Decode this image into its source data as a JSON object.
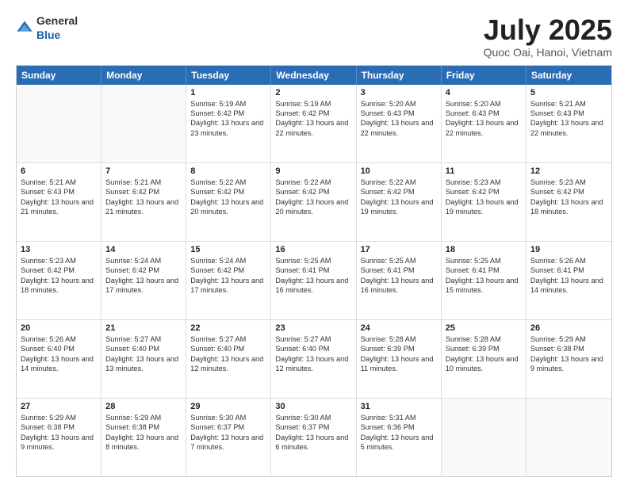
{
  "header": {
    "logo_general": "General",
    "logo_blue": "Blue",
    "month_title": "July 2025",
    "subtitle": "Quoc Oai, Hanoi, Vietnam"
  },
  "calendar": {
    "days_of_week": [
      "Sunday",
      "Monday",
      "Tuesday",
      "Wednesday",
      "Thursday",
      "Friday",
      "Saturday"
    ],
    "rows": [
      [
        {
          "day": "",
          "sunrise": "",
          "sunset": "",
          "daylight": ""
        },
        {
          "day": "",
          "sunrise": "",
          "sunset": "",
          "daylight": ""
        },
        {
          "day": "1",
          "sunrise": "Sunrise: 5:19 AM",
          "sunset": "Sunset: 6:42 PM",
          "daylight": "Daylight: 13 hours and 23 minutes."
        },
        {
          "day": "2",
          "sunrise": "Sunrise: 5:19 AM",
          "sunset": "Sunset: 6:42 PM",
          "daylight": "Daylight: 13 hours and 22 minutes."
        },
        {
          "day": "3",
          "sunrise": "Sunrise: 5:20 AM",
          "sunset": "Sunset: 6:43 PM",
          "daylight": "Daylight: 13 hours and 22 minutes."
        },
        {
          "day": "4",
          "sunrise": "Sunrise: 5:20 AM",
          "sunset": "Sunset: 6:43 PM",
          "daylight": "Daylight: 13 hours and 22 minutes."
        },
        {
          "day": "5",
          "sunrise": "Sunrise: 5:21 AM",
          "sunset": "Sunset: 6:43 PM",
          "daylight": "Daylight: 13 hours and 22 minutes."
        }
      ],
      [
        {
          "day": "6",
          "sunrise": "Sunrise: 5:21 AM",
          "sunset": "Sunset: 6:43 PM",
          "daylight": "Daylight: 13 hours and 21 minutes."
        },
        {
          "day": "7",
          "sunrise": "Sunrise: 5:21 AM",
          "sunset": "Sunset: 6:42 PM",
          "daylight": "Daylight: 13 hours and 21 minutes."
        },
        {
          "day": "8",
          "sunrise": "Sunrise: 5:22 AM",
          "sunset": "Sunset: 6:42 PM",
          "daylight": "Daylight: 13 hours and 20 minutes."
        },
        {
          "day": "9",
          "sunrise": "Sunrise: 5:22 AM",
          "sunset": "Sunset: 6:42 PM",
          "daylight": "Daylight: 13 hours and 20 minutes."
        },
        {
          "day": "10",
          "sunrise": "Sunrise: 5:22 AM",
          "sunset": "Sunset: 6:42 PM",
          "daylight": "Daylight: 13 hours and 19 minutes."
        },
        {
          "day": "11",
          "sunrise": "Sunrise: 5:23 AM",
          "sunset": "Sunset: 6:42 PM",
          "daylight": "Daylight: 13 hours and 19 minutes."
        },
        {
          "day": "12",
          "sunrise": "Sunrise: 5:23 AM",
          "sunset": "Sunset: 6:42 PM",
          "daylight": "Daylight: 13 hours and 18 minutes."
        }
      ],
      [
        {
          "day": "13",
          "sunrise": "Sunrise: 5:23 AM",
          "sunset": "Sunset: 6:42 PM",
          "daylight": "Daylight: 13 hours and 18 minutes."
        },
        {
          "day": "14",
          "sunrise": "Sunrise: 5:24 AM",
          "sunset": "Sunset: 6:42 PM",
          "daylight": "Daylight: 13 hours and 17 minutes."
        },
        {
          "day": "15",
          "sunrise": "Sunrise: 5:24 AM",
          "sunset": "Sunset: 6:42 PM",
          "daylight": "Daylight: 13 hours and 17 minutes."
        },
        {
          "day": "16",
          "sunrise": "Sunrise: 5:25 AM",
          "sunset": "Sunset: 6:41 PM",
          "daylight": "Daylight: 13 hours and 16 minutes."
        },
        {
          "day": "17",
          "sunrise": "Sunrise: 5:25 AM",
          "sunset": "Sunset: 6:41 PM",
          "daylight": "Daylight: 13 hours and 16 minutes."
        },
        {
          "day": "18",
          "sunrise": "Sunrise: 5:25 AM",
          "sunset": "Sunset: 6:41 PM",
          "daylight": "Daylight: 13 hours and 15 minutes."
        },
        {
          "day": "19",
          "sunrise": "Sunrise: 5:26 AM",
          "sunset": "Sunset: 6:41 PM",
          "daylight": "Daylight: 13 hours and 14 minutes."
        }
      ],
      [
        {
          "day": "20",
          "sunrise": "Sunrise: 5:26 AM",
          "sunset": "Sunset: 6:40 PM",
          "daylight": "Daylight: 13 hours and 14 minutes."
        },
        {
          "day": "21",
          "sunrise": "Sunrise: 5:27 AM",
          "sunset": "Sunset: 6:40 PM",
          "daylight": "Daylight: 13 hours and 13 minutes."
        },
        {
          "day": "22",
          "sunrise": "Sunrise: 5:27 AM",
          "sunset": "Sunset: 6:40 PM",
          "daylight": "Daylight: 13 hours and 12 minutes."
        },
        {
          "day": "23",
          "sunrise": "Sunrise: 5:27 AM",
          "sunset": "Sunset: 6:40 PM",
          "daylight": "Daylight: 13 hours and 12 minutes."
        },
        {
          "day": "24",
          "sunrise": "Sunrise: 5:28 AM",
          "sunset": "Sunset: 6:39 PM",
          "daylight": "Daylight: 13 hours and 11 minutes."
        },
        {
          "day": "25",
          "sunrise": "Sunrise: 5:28 AM",
          "sunset": "Sunset: 6:39 PM",
          "daylight": "Daylight: 13 hours and 10 minutes."
        },
        {
          "day": "26",
          "sunrise": "Sunrise: 5:29 AM",
          "sunset": "Sunset: 6:38 PM",
          "daylight": "Daylight: 13 hours and 9 minutes."
        }
      ],
      [
        {
          "day": "27",
          "sunrise": "Sunrise: 5:29 AM",
          "sunset": "Sunset: 6:38 PM",
          "daylight": "Daylight: 13 hours and 9 minutes."
        },
        {
          "day": "28",
          "sunrise": "Sunrise: 5:29 AM",
          "sunset": "Sunset: 6:38 PM",
          "daylight": "Daylight: 13 hours and 8 minutes."
        },
        {
          "day": "29",
          "sunrise": "Sunrise: 5:30 AM",
          "sunset": "Sunset: 6:37 PM",
          "daylight": "Daylight: 13 hours and 7 minutes."
        },
        {
          "day": "30",
          "sunrise": "Sunrise: 5:30 AM",
          "sunset": "Sunset: 6:37 PM",
          "daylight": "Daylight: 13 hours and 6 minutes."
        },
        {
          "day": "31",
          "sunrise": "Sunrise: 5:31 AM",
          "sunset": "Sunset: 6:36 PM",
          "daylight": "Daylight: 13 hours and 5 minutes."
        },
        {
          "day": "",
          "sunrise": "",
          "sunset": "",
          "daylight": ""
        },
        {
          "day": "",
          "sunrise": "",
          "sunset": "",
          "daylight": ""
        }
      ]
    ]
  }
}
